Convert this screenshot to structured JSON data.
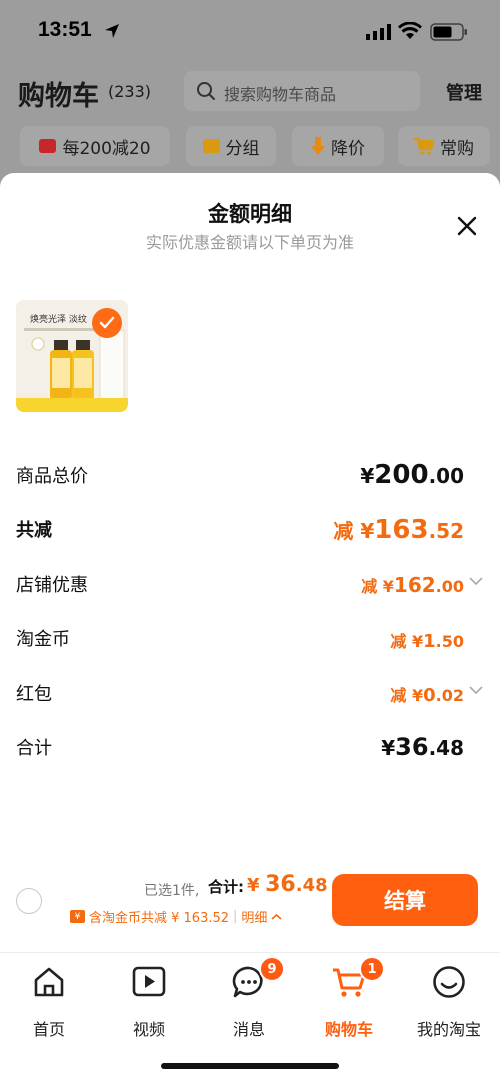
{
  "status_bar": {
    "time": "13:51"
  },
  "header": {
    "title": "购物车",
    "count": "(233)",
    "search_placeholder": "搜索购物车商品",
    "manage": "管理"
  },
  "chips": [
    {
      "label": "每200减20",
      "icon": "coupon-icon",
      "color": "#c8262a"
    },
    {
      "label": "分组",
      "icon": "folder-icon",
      "color": "#d99a12"
    },
    {
      "label": "降价",
      "icon": "price-drop-icon",
      "color": "#e58a12"
    },
    {
      "label": "常购",
      "icon": "cart-icon",
      "color": "#d99a12"
    }
  ],
  "sheet": {
    "title": "金额明细",
    "subtitle": "实际优惠金额请以下单页为准",
    "product_banner": "焕亮光泽 淡纹",
    "rows": [
      {
        "label": "商品总价",
        "prefix": "",
        "yuan": "¥",
        "integer": "200",
        "decimal": ".00"
      },
      {
        "label": "共减",
        "prefix": "减 ",
        "yuan": "¥",
        "integer": "163",
        "decimal": ".52"
      },
      {
        "label": "店铺优惠",
        "prefix": "减 ",
        "yuan": "¥",
        "integer": "162",
        "decimal": ".00"
      },
      {
        "label": "淘金币",
        "prefix": "减 ",
        "yuan": "¥",
        "integer": "1",
        "decimal": ".50"
      },
      {
        "label": "红包",
        "prefix": "减 ",
        "yuan": "¥",
        "integer": "0",
        "decimal": ".02"
      },
      {
        "label": "合计",
        "prefix": "",
        "yuan": "¥",
        "integer": "36",
        "decimal": ".48"
      }
    ]
  },
  "checkout": {
    "selected": "已选1件,",
    "total_label": "合计:",
    "total_yuan": "¥",
    "total_int": "36",
    "total_dec": ".48",
    "coin_icon": "¥",
    "coin_text": "含淘金币共减 ¥ 163.52",
    "detail_label": "明细",
    "settle_label": "结算"
  },
  "tabs": [
    {
      "label": "首页",
      "icon": "home-icon"
    },
    {
      "label": "视频",
      "icon": "video-play-icon"
    },
    {
      "label": "消息",
      "icon": "message-icon",
      "badge": "9"
    },
    {
      "label": "购物车",
      "icon": "cart-icon",
      "badge": "1",
      "active": true
    },
    {
      "label": "我的淘宝",
      "icon": "profile-smile-icon"
    }
  ],
  "colors": {
    "accent": "#ff5f0f",
    "accent_text": "#f36b10"
  }
}
